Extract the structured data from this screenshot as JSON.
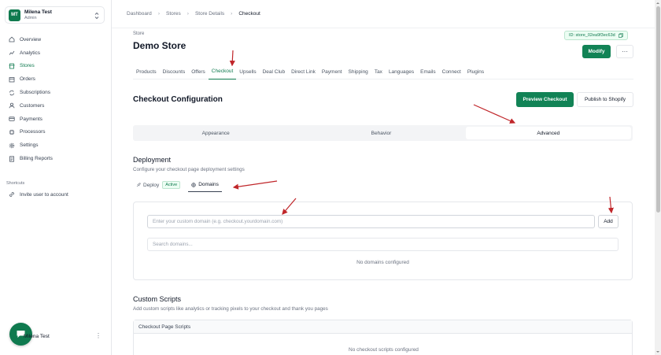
{
  "workspace": {
    "initials": "MT",
    "name": "Milena Test",
    "role": "Admin"
  },
  "sidebar": {
    "items": [
      {
        "label": "Overview",
        "icon": "home-icon",
        "active": false
      },
      {
        "label": "Analytics",
        "icon": "chart-line-icon",
        "active": false
      },
      {
        "label": "Stores",
        "icon": "store-icon",
        "active": true
      },
      {
        "label": "Orders",
        "icon": "box-icon",
        "active": false
      },
      {
        "label": "Subscriptions",
        "icon": "repeat-icon",
        "active": false
      },
      {
        "label": "Customers",
        "icon": "user-icon",
        "active": false
      },
      {
        "label": "Payments",
        "icon": "credit-card-icon",
        "active": false
      },
      {
        "label": "Processors",
        "icon": "processor-icon",
        "active": false
      },
      {
        "label": "Settings",
        "icon": "gear-icon",
        "active": false
      },
      {
        "label": "Billing Reports",
        "icon": "report-icon",
        "active": false
      }
    ],
    "shortcuts_title": "Shortcuts",
    "shortcut_invite": "Invite user to account",
    "user_name": "Milena Test",
    "more": "⋮"
  },
  "breadcrumb": [
    "Dashboard",
    "Stores",
    "Store Details",
    "Checkout"
  ],
  "store": {
    "label": "Store",
    "title": "Demo Store",
    "id": "ID: store_02ea9f3ec63d",
    "modify": "Modify",
    "more": "···"
  },
  "tabs": [
    "Products",
    "Discounts",
    "Offers",
    "Checkout",
    "Upsells",
    "Deal Club",
    "Direct Link",
    "Payment",
    "Shipping",
    "Tax",
    "Languages",
    "Emails",
    "Connect",
    "Plugins"
  ],
  "active_tab": "Checkout",
  "checkout": {
    "title": "Checkout Configuration",
    "preview": "Preview Checkout",
    "publish": "Publish to Shopify",
    "segments": [
      "Appearance",
      "Behavior",
      "Advanced"
    ],
    "active_segment": "Advanced"
  },
  "deployment": {
    "title": "Deployment",
    "subtitle": "Configure your checkout page deployment settings",
    "tab_deploy": "Deploy",
    "badge": "Active",
    "tab_domains": "Domains",
    "domain_placeholder": "Enter your custom domain (e.g. checkout.yourdomain.com)",
    "add": "Add",
    "search_placeholder": "Search domains...",
    "empty": "No domains configured"
  },
  "scripts": {
    "title": "Custom Scripts",
    "subtitle": "Add custom scripts like analytics or tracking pixels to your checkout and thank you pages",
    "table_header": "Checkout Page Scripts",
    "empty": "No checkout scripts configured"
  },
  "colors": {
    "brand": "#128356",
    "annotation": "#c0262a"
  }
}
